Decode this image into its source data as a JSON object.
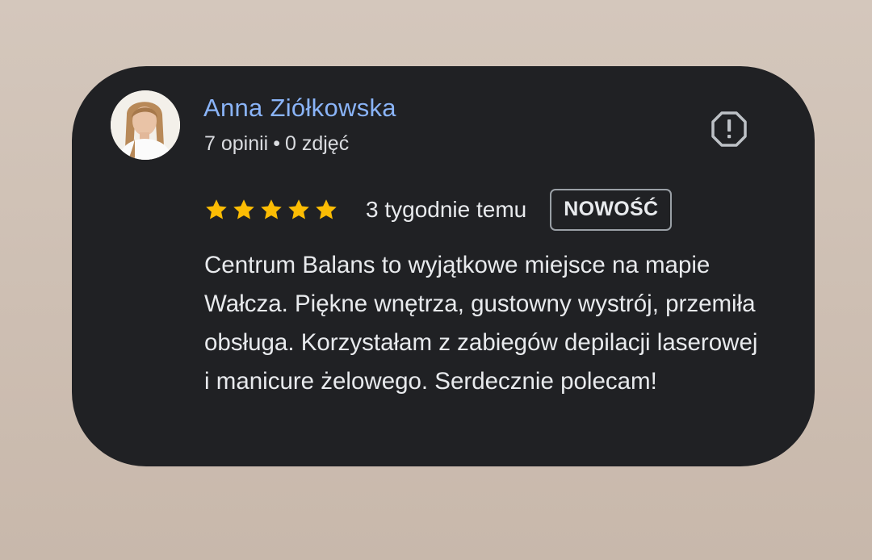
{
  "review": {
    "author": {
      "name": "Anna Ziółkowska",
      "reviews_count": "7 opinii",
      "separator": "•",
      "photos_count": "0 zdjęć"
    },
    "rating": 5,
    "time_ago": "3 tygodnie temu",
    "badge": "NOWOŚĆ",
    "text": "Centrum Balans to wyjątkowe miejsce na mapie Wałcza. Piękne wnętrza, gustowny wystrój, przemiła obsługa. Korzystałam z zabiegów depilacji laserowej i manicure żelowego. Serdecznie polecam!"
  },
  "icons": {
    "star": "star-icon",
    "report": "report-flag-icon"
  },
  "colors": {
    "card_background": "#202124",
    "author_name": "#8ab4f8",
    "star": "#fbbc04",
    "text": "#e8eaed"
  }
}
